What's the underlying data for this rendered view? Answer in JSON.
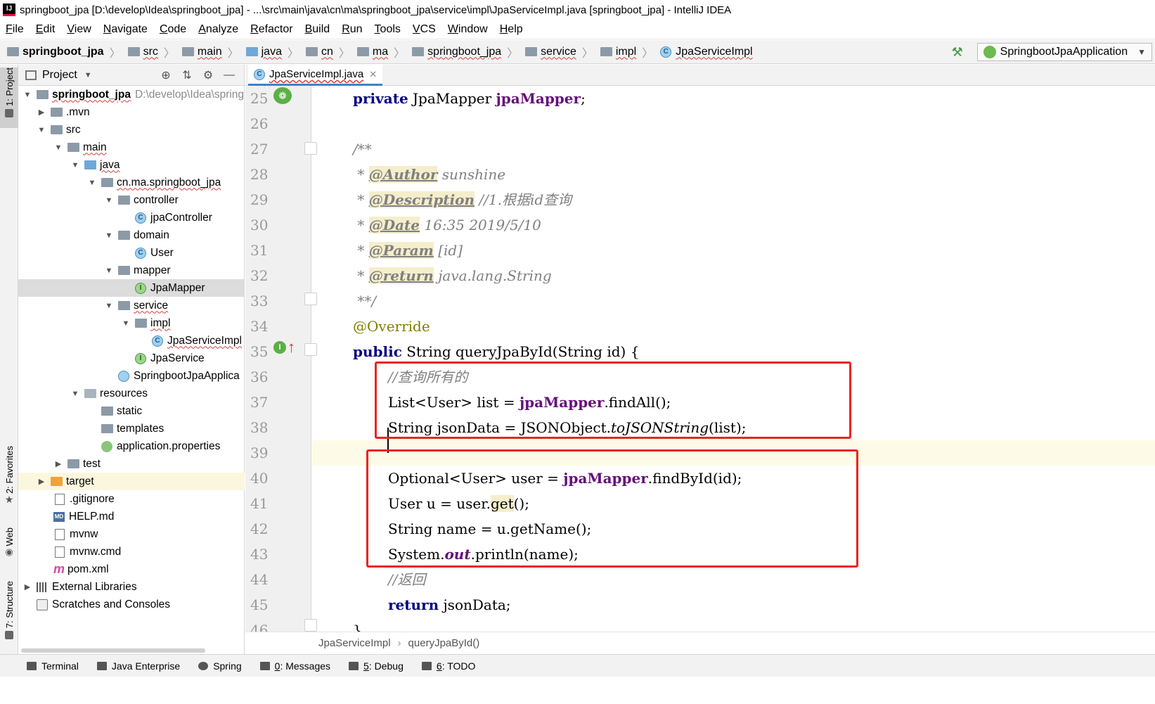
{
  "window": {
    "title": "springboot_jpa [D:\\develop\\Idea\\springboot_jpa] - ...\\src\\main\\java\\cn\\ma\\springboot_jpa\\service\\impl\\JpaServiceImpl.java [springboot_jpa] - IntelliJ IDEA",
    "app_icon": "IJ"
  },
  "menu": [
    "File",
    "Edit",
    "View",
    "Navigate",
    "Code",
    "Analyze",
    "Refactor",
    "Build",
    "Run",
    "Tools",
    "VCS",
    "Window",
    "Help"
  ],
  "nav": {
    "crumbs": [
      "springboot_jpa",
      "src",
      "main",
      "java",
      "cn",
      "ma",
      "springboot_jpa",
      "service",
      "impl",
      "JpaServiceImpl"
    ],
    "run_config": "SpringbootJpaApplication"
  },
  "left_strip": {
    "project": "1: Project",
    "favorites": "2: Favorites",
    "web": "Web",
    "structure": "7: Structure"
  },
  "project_panel": {
    "title": "Project",
    "root_path": "D:\\develop\\Idea\\spring",
    "tree": [
      {
        "label": "springboot_jpa"
      },
      {
        "label": ".mvn"
      },
      {
        "label": "src"
      },
      {
        "label": "main"
      },
      {
        "label": "java"
      },
      {
        "label": "cn.ma.springboot_jpa"
      },
      {
        "label": "controller"
      },
      {
        "label": "jpaController"
      },
      {
        "label": "domain"
      },
      {
        "label": "User"
      },
      {
        "label": "mapper"
      },
      {
        "label": "JpaMapper"
      },
      {
        "label": "service"
      },
      {
        "label": "impl"
      },
      {
        "label": "JpaServiceImpl"
      },
      {
        "label": "JpaService"
      },
      {
        "label": "SpringbootJpaApplica"
      },
      {
        "label": "resources"
      },
      {
        "label": "static"
      },
      {
        "label": "templates"
      },
      {
        "label": "application.properties"
      },
      {
        "label": "test"
      },
      {
        "label": "target"
      },
      {
        "label": ".gitignore"
      },
      {
        "label": "HELP.md"
      },
      {
        "label": "mvnw"
      },
      {
        "label": "mvnw.cmd"
      },
      {
        "label": "pom.xml"
      },
      {
        "label": "External Libraries"
      },
      {
        "label": "Scratches and Consoles"
      }
    ]
  },
  "editor": {
    "tab": "JpaServiceImpl.java",
    "line_numbers": [
      "25",
      "26",
      "27",
      "28",
      "29",
      "30",
      "31",
      "32",
      "33",
      "34",
      "35",
      "36",
      "37",
      "38",
      "39",
      "40",
      "41",
      "42",
      "43",
      "44",
      "45",
      "46"
    ],
    "code": {
      "l25_kw": "private",
      "l25_type": " JpaMapper ",
      "l25_field": "jpaMapper",
      "l25_end": ";",
      "l27": "/**",
      "l28_star": " * ",
      "l28_tag": "@Author",
      "l28_txt": " sunshine",
      "l29_star": " * ",
      "l29_tag": "@Description",
      "l29_txt": " //1.根据id查询",
      "l30_star": " * ",
      "l30_tag": "@Date",
      "l30_txt": " 16:35 2019/5/10",
      "l31_star": " * ",
      "l31_tag": "@Param",
      "l31_txt": " [id]",
      "l32_star": " * ",
      "l32_tag": "@return",
      "l32_txt": " java.lang.String",
      "l33": " **/",
      "l34": "@Override",
      "l35_kw": "public",
      "l35_rest": " String queryJpaById(String id) {",
      "l36": "//查询所有的",
      "l37_a": "List<User> list = ",
      "l37_field": "jpaMapper",
      "l37_b": ".findAll();",
      "l38_a": "String jsonData = JSONObject.",
      "l38_it": "toJSONString",
      "l38_b": "(list);",
      "l40_a": "Optional<User> user = ",
      "l40_field": "jpaMapper",
      "l40_b": ".findById(id);",
      "l41_a": "User u = user.",
      "l41_hl": "get",
      "l41_b": "();",
      "l42": "String name = u.getName();",
      "l43_a": "System.",
      "l43_static": "out",
      "l43_b": ".println(name);",
      "l44": "//返回",
      "l45_kw": "return",
      "l45_rest": " jsonData;",
      "l46": "}"
    },
    "breadcrumb": [
      "JpaServiceImpl",
      "queryJpaById()"
    ]
  },
  "bottom_tools": [
    {
      "label": "Terminal"
    },
    {
      "label": "Java Enterprise"
    },
    {
      "label": "Spring"
    },
    {
      "key": "0",
      "label": ": Messages"
    },
    {
      "key": "5",
      "label": ": Debug"
    },
    {
      "key": "6",
      "label": ": TODO"
    }
  ],
  "colors": {
    "keyword": "#000080",
    "field": "#660e7a",
    "comment": "#808080",
    "annotation": "#808000",
    "highlight_box": "#ee2222"
  }
}
